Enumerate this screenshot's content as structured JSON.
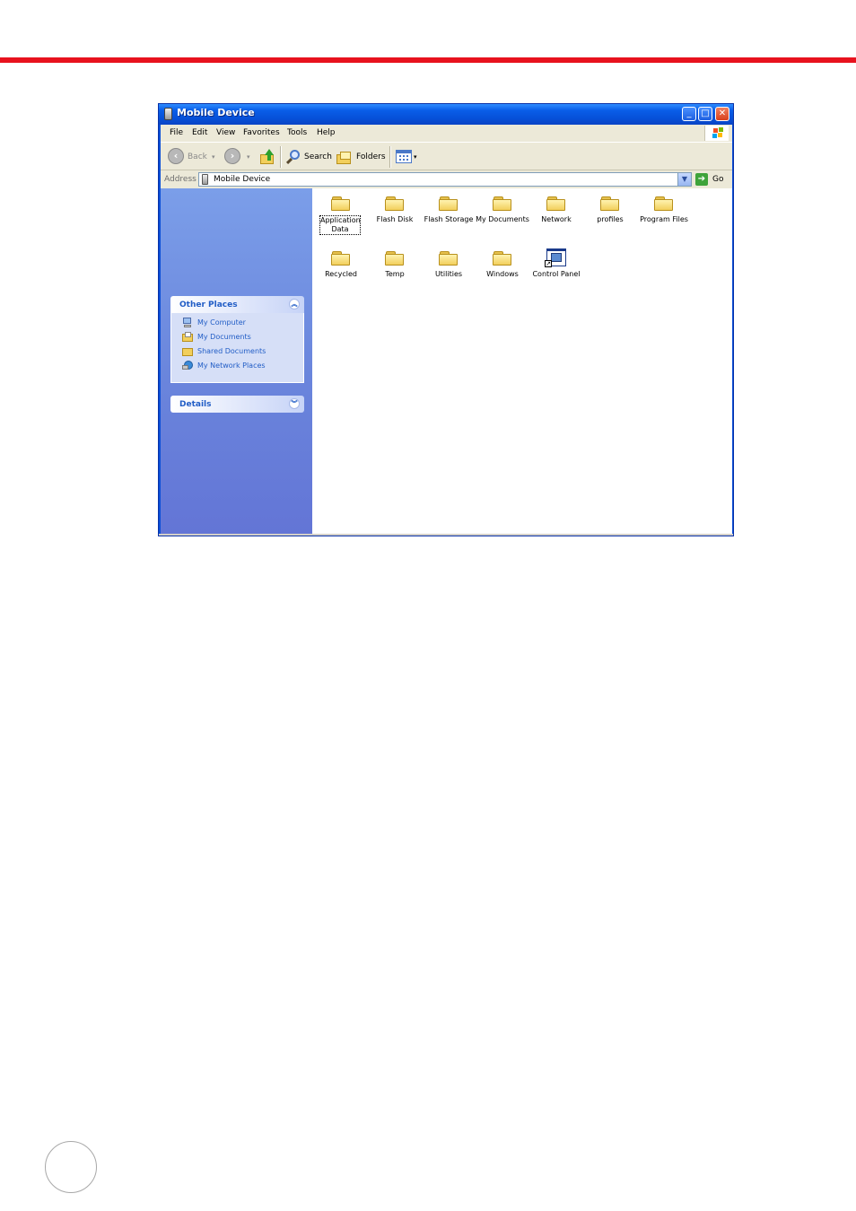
{
  "window": {
    "title": "Mobile Device",
    "buttons": {
      "minimize": "_",
      "maximize": "□",
      "close": "✕"
    }
  },
  "menu": [
    "File",
    "Edit",
    "View",
    "Favorites",
    "Tools",
    "Help"
  ],
  "toolbar": {
    "back_label": "Back",
    "search_label": "Search",
    "folders_label": "Folders"
  },
  "address": {
    "label": "Address",
    "value": "Mobile Device",
    "go_label": "Go"
  },
  "tasks": {
    "other_places": {
      "title": "Other Places",
      "items": [
        "My Computer",
        "My Documents",
        "Shared Documents",
        "My Network Places"
      ]
    },
    "details": {
      "title": "Details"
    }
  },
  "files": [
    {
      "name": "Application Data",
      "icon": "folder-icon",
      "selected": true
    },
    {
      "name": "Flash Disk",
      "icon": "folder-icon"
    },
    {
      "name": "Flash Storage",
      "icon": "folder-icon"
    },
    {
      "name": "My Documents",
      "icon": "folder-icon"
    },
    {
      "name": "Network",
      "icon": "folder-icon"
    },
    {
      "name": "profiles",
      "icon": "folder-icon"
    },
    {
      "name": "Program Files",
      "icon": "folder-icon"
    },
    {
      "name": "Recycled",
      "icon": "folder-icon"
    },
    {
      "name": "Temp",
      "icon": "folder-icon"
    },
    {
      "name": "Utilities",
      "icon": "folder-icon"
    },
    {
      "name": "Windows",
      "icon": "folder-icon"
    },
    {
      "name": "Control Panel",
      "icon": "control-panel-shortcut-icon"
    }
  ],
  "colors": {
    "page_accent_line": "#e8121e",
    "titlebar": "#0a5ee8",
    "task_pane": "#6a85dc",
    "link_blue": "#215dc6"
  }
}
